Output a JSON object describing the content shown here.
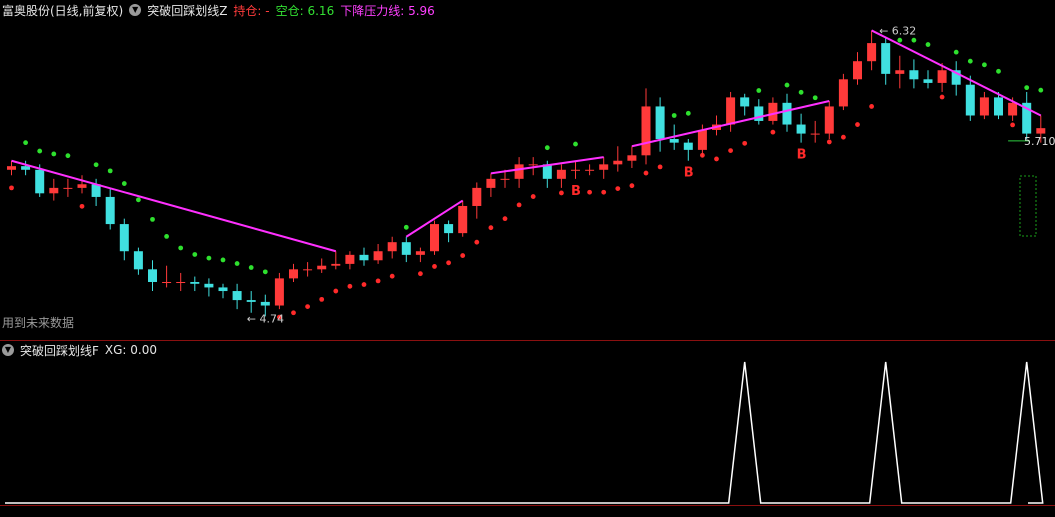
{
  "header": {
    "stock": "富奥股份(日线,前复权)",
    "indicator": "突破回踩划线Z",
    "hold_label": "持仓: -",
    "empty_label": "空仓: ",
    "empty_value": "6.16",
    "pressure_label": "下降压力线: ",
    "pressure_value": "5.96"
  },
  "lower_header": {
    "indicator": "突破回踩划线F",
    "xg_label": "XG: ",
    "xg_value": "0.00"
  },
  "note": "用到未来数据",
  "labels": {
    "high": "6.32",
    "low": "4.74",
    "last": "5.710",
    "buy": "B"
  },
  "colors": {
    "up": "#ff3a3a",
    "down": "#40e0e0",
    "ma_down": "#2ee02e",
    "ma_up": "#ff2a2a",
    "pressure": "#ff30ff",
    "signal": "#ffffff"
  },
  "chart_data": [
    {
      "type": "candlestick",
      "series": [
        {
          "name": "open",
          "values": [
            5.55,
            5.57,
            5.55,
            5.42,
            5.45,
            5.45,
            5.47,
            5.4,
            5.25,
            5.1,
            5.0,
            4.93,
            4.93,
            4.93,
            4.92,
            4.9,
            4.88,
            4.83,
            4.82,
            4.8,
            4.95,
            5.0,
            5.0,
            5.02,
            5.03,
            5.08,
            5.05,
            5.1,
            5.15,
            5.08,
            5.1,
            5.25,
            5.2,
            5.35,
            5.45,
            5.5,
            5.5,
            5.58,
            5.58,
            5.5,
            5.55,
            5.55,
            5.55,
            5.58,
            5.6,
            5.63,
            5.9,
            5.72,
            5.7,
            5.66,
            5.77,
            5.8,
            5.95,
            5.9,
            5.82,
            5.92,
            5.8,
            5.75,
            5.75,
            5.9,
            6.05,
            6.15,
            6.25,
            6.08,
            6.1,
            6.05,
            6.03,
            6.1,
            6.02,
            5.85,
            5.95,
            5.85,
            5.92,
            5.75
          ]
        },
        {
          "name": "close",
          "values": [
            5.57,
            5.55,
            5.42,
            5.45,
            5.45,
            5.47,
            5.4,
            5.25,
            5.1,
            5.0,
            4.93,
            4.93,
            4.93,
            4.92,
            4.9,
            4.88,
            4.83,
            4.82,
            4.8,
            4.95,
            5.0,
            5.0,
            5.02,
            5.03,
            5.08,
            5.05,
            5.1,
            5.15,
            5.08,
            5.1,
            5.25,
            5.2,
            5.35,
            5.45,
            5.5,
            5.5,
            5.58,
            5.58,
            5.5,
            5.55,
            5.55,
            5.55,
            5.58,
            5.6,
            5.63,
            5.9,
            5.72,
            5.7,
            5.66,
            5.77,
            5.8,
            5.95,
            5.9,
            5.82,
            5.92,
            5.8,
            5.75,
            5.75,
            5.9,
            6.05,
            6.15,
            6.25,
            6.08,
            6.1,
            6.05,
            6.03,
            6.1,
            6.02,
            5.85,
            5.95,
            5.85,
            5.92,
            5.75,
            5.78
          ]
        },
        {
          "name": "high",
          "values": [
            5.6,
            5.6,
            5.58,
            5.5,
            5.5,
            5.52,
            5.5,
            5.45,
            5.28,
            5.12,
            5.05,
            5.02,
            4.98,
            4.96,
            4.95,
            4.92,
            4.92,
            4.88,
            4.86,
            4.98,
            5.03,
            5.04,
            5.06,
            5.1,
            5.1,
            5.12,
            5.14,
            5.18,
            5.18,
            5.12,
            5.27,
            5.27,
            5.38,
            5.48,
            5.53,
            5.55,
            5.62,
            5.62,
            5.6,
            5.58,
            5.6,
            5.58,
            5.62,
            5.68,
            5.68,
            6.0,
            5.95,
            5.8,
            5.72,
            5.8,
            5.85,
            5.98,
            5.97,
            5.94,
            5.95,
            5.97,
            5.86,
            5.82,
            5.93,
            6.08,
            6.2,
            6.32,
            6.28,
            6.18,
            6.16,
            6.1,
            6.14,
            6.15,
            6.07,
            5.98,
            5.98,
            5.95,
            5.98,
            5.85
          ]
        },
        {
          "name": "low",
          "values": [
            5.52,
            5.52,
            5.4,
            5.38,
            5.4,
            5.42,
            5.35,
            5.22,
            5.05,
            4.97,
            4.88,
            4.9,
            4.88,
            4.88,
            4.85,
            4.84,
            4.78,
            4.76,
            4.74,
            4.78,
            4.93,
            4.96,
            4.98,
            5.0,
            5.0,
            5.02,
            5.03,
            5.06,
            5.04,
            5.04,
            5.08,
            5.15,
            5.18,
            5.28,
            5.4,
            5.45,
            5.45,
            5.52,
            5.45,
            5.45,
            5.5,
            5.52,
            5.5,
            5.54,
            5.56,
            5.58,
            5.65,
            5.66,
            5.6,
            5.62,
            5.74,
            5.76,
            5.85,
            5.8,
            5.8,
            5.76,
            5.7,
            5.7,
            5.72,
            5.88,
            6.02,
            6.1,
            6.02,
            6.0,
            6.0,
            6.0,
            5.98,
            5.96,
            5.82,
            5.83,
            5.83,
            5.82,
            5.72,
            5.7
          ]
        }
      ],
      "annotations": {
        "high": 6.32,
        "low": 4.74,
        "last": 5.71
      }
    },
    {
      "type": "line",
      "series": [
        {
          "name": "XG",
          "values": [
            0,
            0,
            0,
            0,
            0,
            0,
            0,
            0,
            0,
            0,
            0,
            0,
            0,
            0,
            0,
            0,
            0,
            0,
            0,
            0,
            0,
            0,
            0,
            0,
            0,
            0,
            0,
            0,
            0,
            0,
            0,
            0,
            0,
            0,
            0,
            0,
            0,
            0,
            0,
            0,
            0,
            0,
            0,
            0,
            0,
            0,
            0,
            0,
            0,
            0,
            0,
            0,
            1,
            0,
            0,
            0,
            0,
            0,
            0,
            0,
            0,
            0,
            1,
            0,
            0,
            0,
            0,
            0,
            0,
            0,
            0,
            0,
            1,
            0
          ]
        }
      ]
    }
  ]
}
